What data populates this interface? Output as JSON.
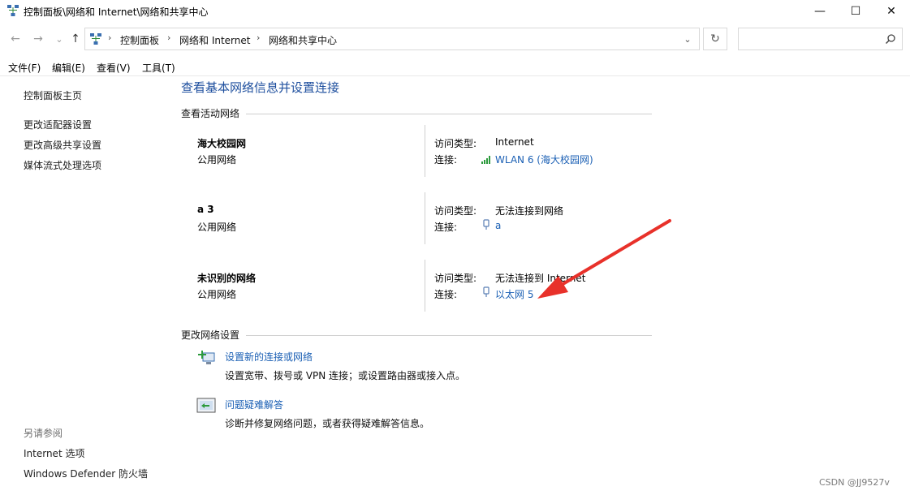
{
  "window": {
    "title": "控制面板\\网络和 Internet\\网络和共享中心",
    "minimize": "—",
    "maximize": "☐",
    "close": "✕"
  },
  "nav": {
    "back": "←",
    "forward": "→",
    "recent": "⌄",
    "up": "↑",
    "breadcrumbs": [
      "控制面板",
      "网络和 Internet",
      "网络和共享中心"
    ],
    "separator": "›",
    "dropdown": "⌄",
    "refresh": "↻",
    "search_placeholder": ""
  },
  "menu": [
    "文件(F)",
    "编辑(E)",
    "查看(V)",
    "工具(T)"
  ],
  "sidebar": {
    "home": "控制面板主页",
    "links": [
      "更改适配器设置",
      "更改高级共享设置",
      "媒体流式处理选项"
    ],
    "see_also_title": "另请参阅",
    "see_also": [
      "Internet 选项",
      "Windows Defender 防火墙"
    ]
  },
  "main": {
    "title": "查看基本网络信息并设置连接",
    "active_networks_title": "查看活动网络",
    "networks": [
      {
        "name": "海大校园网",
        "type": "公用网络",
        "access_key": "访问类型:",
        "access_val": "Internet",
        "conn_key": "连接:",
        "conn_val": "WLAN 6 (海大校园网)",
        "conn_icon": "wifi-signal-icon"
      },
      {
        "name": "a 3",
        "type": "公用网络",
        "access_key": "访问类型:",
        "access_val": "无法连接到网络",
        "conn_key": "连接:",
        "conn_val": "a",
        "conn_icon": "ethernet-icon"
      },
      {
        "name": "未识别的网络",
        "type": "公用网络",
        "access_key": "访问类型:",
        "access_val": "无法连接到 Internet",
        "conn_key": "连接:",
        "conn_val": "以太网 5",
        "conn_icon": "ethernet-icon"
      }
    ],
    "change_settings_title": "更改网络设置",
    "tasks": [
      {
        "link": "设置新的连接或网络",
        "desc": "设置宽带、拨号或 VPN 连接；或设置路由器或接入点。",
        "icon": "new-connection-icon"
      },
      {
        "link": "问题疑难解答",
        "desc": "诊断并修复网络问题，或者获得疑难解答信息。",
        "icon": "troubleshoot-icon"
      }
    ]
  },
  "watermark": "CSDN @JJ9527v",
  "colors": {
    "link": "#1a5fb4",
    "title": "#1e4f9e",
    "arrow": "#e8312a"
  }
}
